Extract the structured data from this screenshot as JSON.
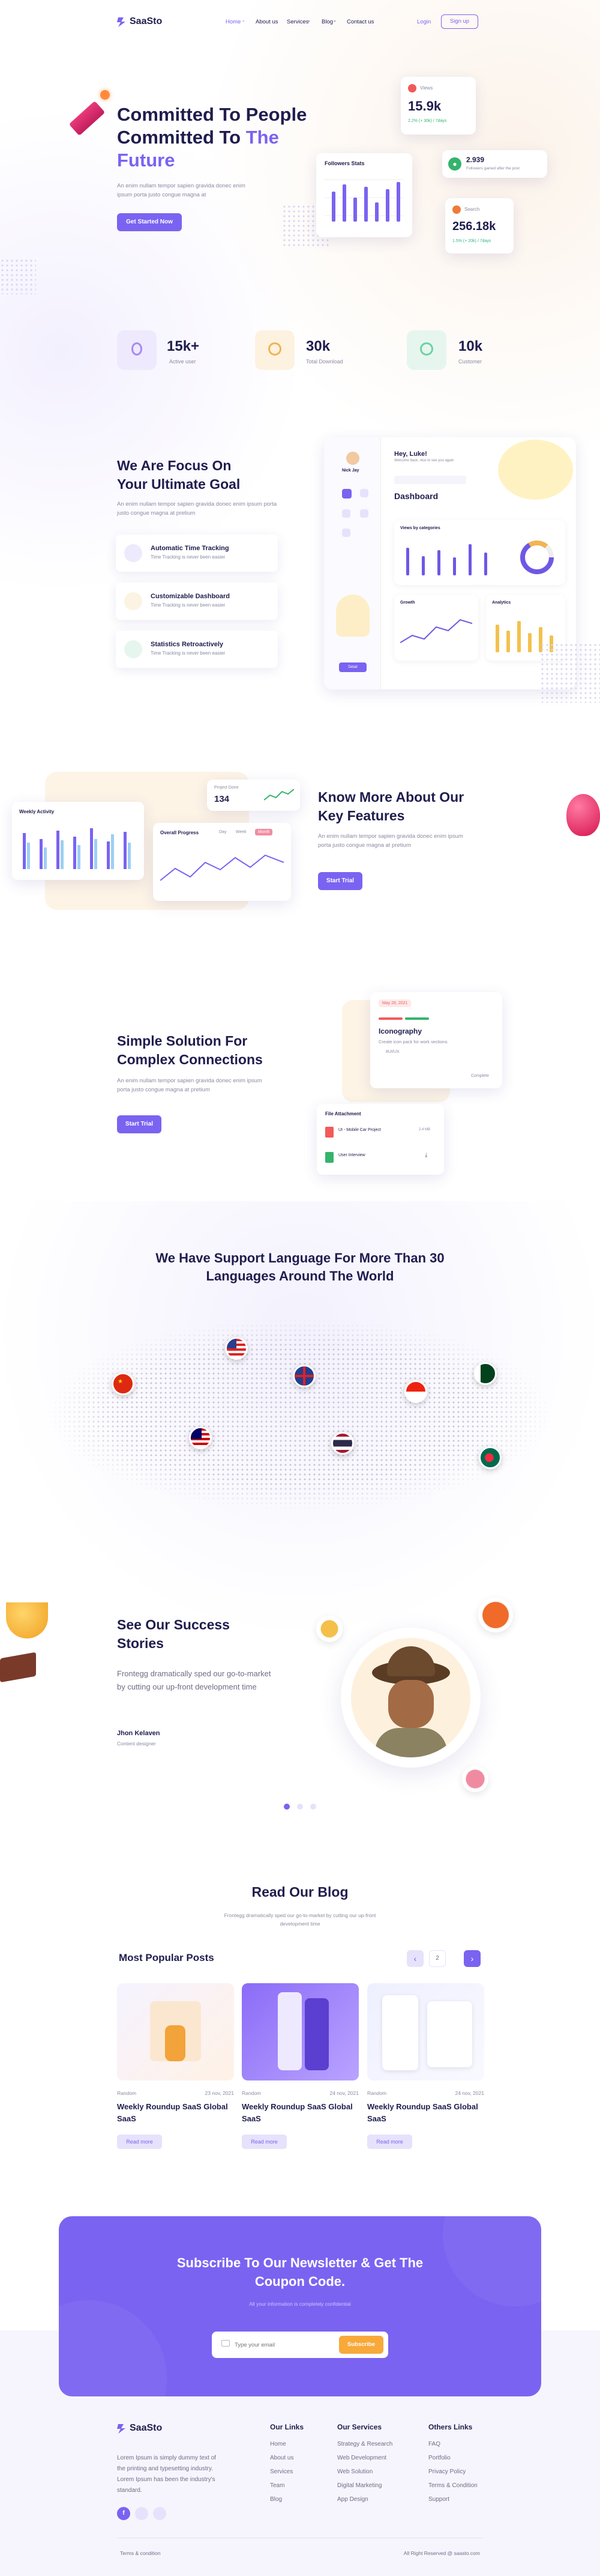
{
  "brand": {
    "name": "SaaSto"
  },
  "nav": {
    "items": [
      "Home",
      "About us",
      "Services",
      "Blog",
      "Contact us"
    ],
    "login": "Login",
    "signup": "Sign up"
  },
  "hero": {
    "title_line1": "Committed To People",
    "title_line2": "Committed To",
    "title_highlight": "The",
    "title_line3": "Future",
    "desc": "An enim nullam tempor sapien gravida donec enim ipsum porta justo congue magna at",
    "cta": "Get Started Now",
    "stats_card_title": "Followers Stats",
    "card_views_label": "Views",
    "card_views_value": "15.9k",
    "card_views_sub": "2.2% (+ 30k) / 7days",
    "card_users_value": "2.939",
    "card_users_sub": "Followers gained after the post",
    "card_search_label": "Search",
    "card_search_value": "256.18k",
    "card_search_sub": "1.5% (+ 20k) / 7days"
  },
  "stats": [
    {
      "value": "15k+",
      "label": "Active user",
      "color": "#efe9fd"
    },
    {
      "value": "30k",
      "label": "Total Download",
      "color": "#fdf2e0"
    },
    {
      "value": "10k",
      "label": "Customer",
      "color": "#e6f6ef"
    }
  ],
  "focus": {
    "title_line1": "We Are Focus On",
    "title_line2": "Your Ultimate Goal",
    "desc": "An enim nullam tempor sapien gravida donec enim ipsum porta justo congue magna at pretium",
    "features": [
      {
        "title": "Automatic Time Tracking",
        "sub": "Time Tracking is never been easier",
        "color": "#eeeafd"
      },
      {
        "title": "Customizable Dashboard",
        "sub": "Time Tracking is never been easier",
        "color": "#fdf3e2"
      },
      {
        "title": "Statistics Retroactively",
        "sub": "Time Tracking is never been easier",
        "color": "#e6f6ef"
      }
    ],
    "dash_greeting": "Hey, Luke!",
    "dash_sub": "Welcome back, nice to see you again",
    "dash_title": "Dashboard",
    "dash_panel1": "Views by categories",
    "dash_panel2": "Growth",
    "dash_panel3": "Analytics",
    "dash_user": "Nick Jay",
    "dash_btn": "Detail"
  },
  "keyfeatures": {
    "title_line1": "Know More About Our",
    "title_line2": "Key Features",
    "desc": "An enim nullam tempor sapien gravida donec enim ipsum porta justo congue magna at pretium",
    "cta": "Start Trial",
    "weekly_title": "Weekly Activity",
    "project_label": "Project Done",
    "project_value": "134",
    "overall_title": "Overall Progress",
    "tabs": [
      "Day",
      "Week",
      "Month"
    ]
  },
  "solution": {
    "title_line1": "Simple Solution For",
    "title_line2": "Complex Connections",
    "desc": "An enim nullam tempor sapien gravida donec enim ipsum porta justo congue magna at pretium",
    "cta": "Start Trial",
    "task_date": "May 28, 2021",
    "task_title": "Iconography",
    "task_desc": "Create icon pack for work sections",
    "task_tag": "#UI/UX",
    "task_status": "Complete",
    "file_title": "File Attachment",
    "file1": "UI - Mobile Car Project",
    "file1_size": "2.4 MB",
    "file2": "User Interview"
  },
  "languages": {
    "title_line1": "We Have Support Language For More Than 30",
    "title_line2": "Languages Around The World"
  },
  "stories": {
    "title_line1": "See Our Success",
    "title_line2": "Stories",
    "quote": "Frontegg dramatically sped our go-to-market by cutting our up-front development time",
    "name": "Jhon Kelaven",
    "role": "Content designer"
  },
  "blog": {
    "title": "Read Our Blog",
    "desc": "Frontegg dramatically sped our go-to-market by cutting our up-front development time",
    "popular": "Most Popular Posts",
    "page": "2",
    "posts": [
      {
        "cat": "Random",
        "date": "23 nov, 2021",
        "title": "Weekly Roundup SaaS Global SaaS",
        "btn": "Read more"
      },
      {
        "cat": "Random",
        "date": "24 nov, 2021",
        "title": "Weekly Roundup SaaS Global SaaS",
        "btn": "Read more"
      },
      {
        "cat": "Random",
        "date": "24 nov, 2021",
        "title": "Weekly Roundup SaaS Global SaaS",
        "btn": "Read more"
      }
    ]
  },
  "newsletter": {
    "title_line1": "Subscribe To Our Newsletter & Get The",
    "title_line2": "Coupon Code.",
    "sub": "All your information is completely confidential",
    "placeholder": "Type your email",
    "btn": "Subscribe"
  },
  "footer": {
    "desc": "Lorem Ipsum is simply dummy text of the printing and typesetting industry. Lorem Ipsum has been the industry's standard.",
    "col1_title": "Our Links",
    "col1": [
      "Home",
      "About us",
      "Services",
      "Team",
      "Blog"
    ],
    "col2_title": "Our Services",
    "col2": [
      "Strategy & Research",
      "Web Development",
      "Web Solution",
      "Digital Marketing",
      "App Design"
    ],
    "col3_title": "Others Links",
    "col3": [
      "FAQ",
      "Portfolio",
      "Privacy Policy",
      "Terms & Condition",
      "Support"
    ],
    "terms": "Terms & condition",
    "copyright": "All Right Reserved @ saasto.com"
  }
}
